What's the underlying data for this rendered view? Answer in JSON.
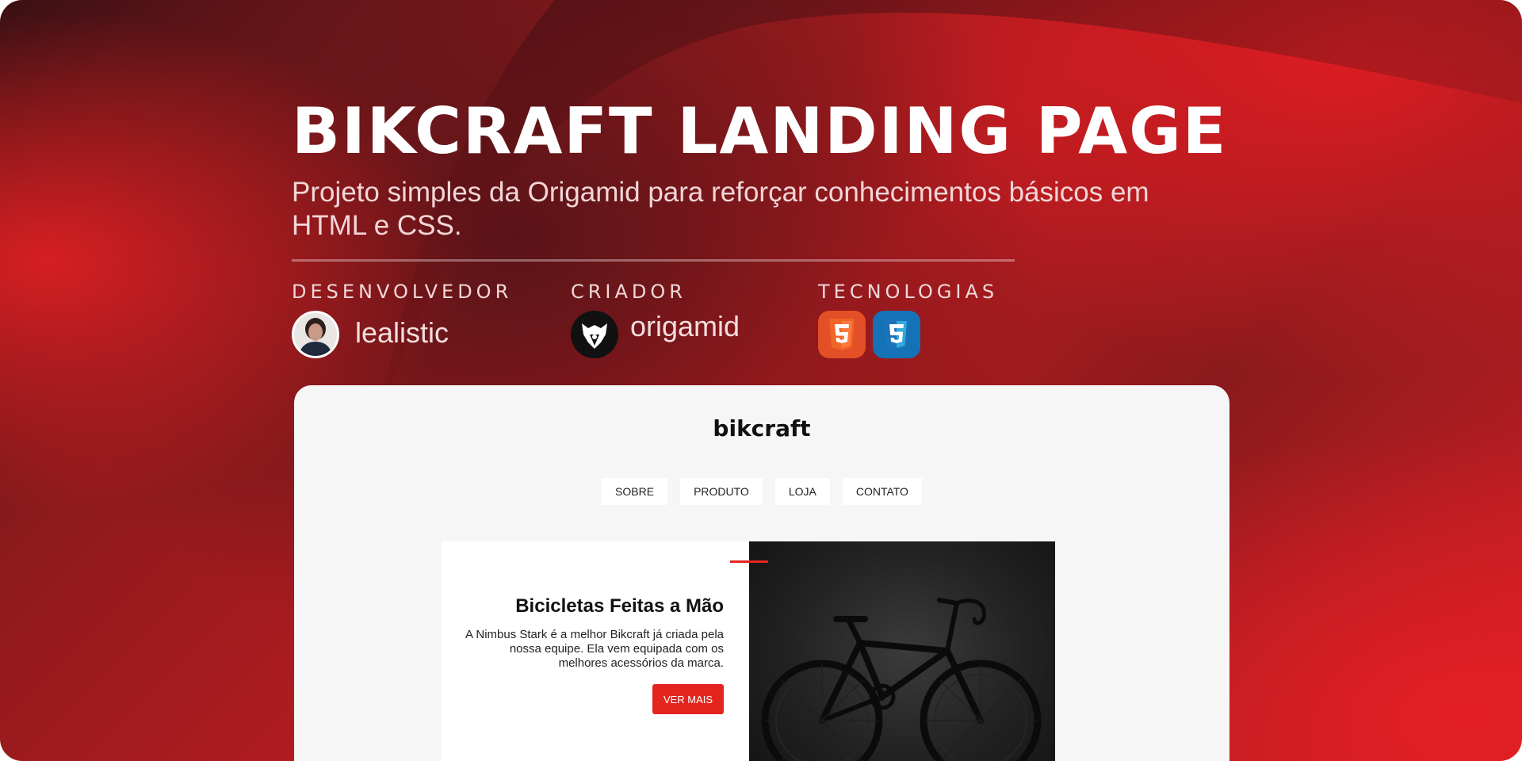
{
  "header": {
    "title": "BIKCRAFT LANDING PAGE",
    "subtitle": "Projeto simples da Origamid para reforçar conhecimentos básicos em HTML e CSS."
  },
  "meta": {
    "developer": {
      "label": "DESENVOLVEDOR",
      "name": "lealistic"
    },
    "creator": {
      "label": "CRIADOR",
      "name": "origamid"
    },
    "technologies": {
      "label": "TECNOLOGIAS",
      "items": [
        "html5-icon",
        "css3-icon"
      ]
    }
  },
  "preview": {
    "logo": "bikcraft",
    "nav": [
      "SOBRE",
      "PRODUTO",
      "LOJA",
      "CONTATO"
    ],
    "intro": {
      "title": "Bicicletas Feitas a Mão",
      "description": "A Nimbus Stark é a melhor Bikcraft já criada pela nossa equipe. Ela vem equipada com os melhores acessórios da marca.",
      "button": "VER MAIS"
    }
  },
  "colors": {
    "accent": "#e4251f",
    "banner_red": "#d21f24",
    "banner_dark": "#3a1013",
    "html5": "#e34f26",
    "css3": "#1572b6"
  }
}
